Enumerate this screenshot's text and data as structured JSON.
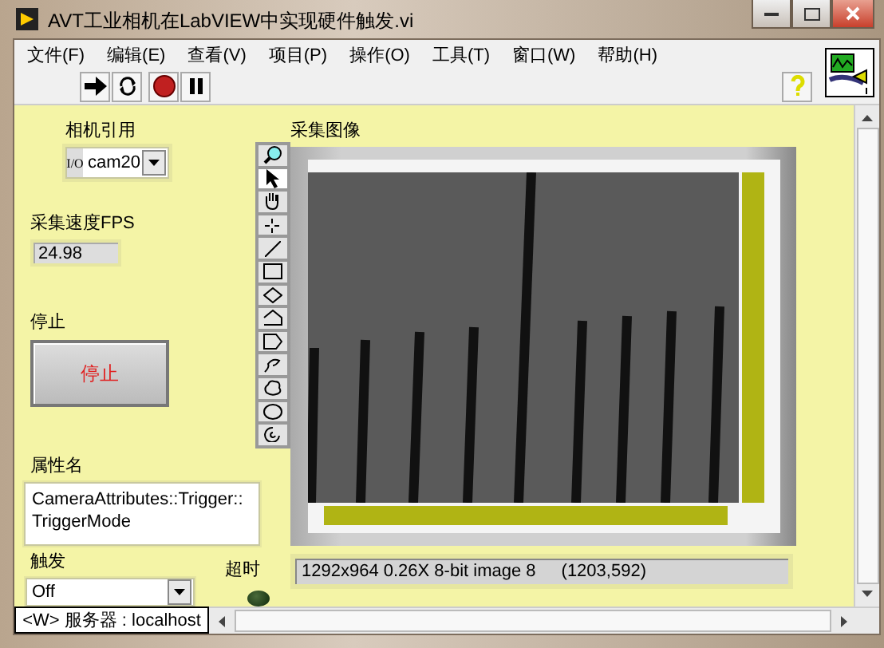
{
  "window": {
    "title": "AVT工业相机在LabVIEW中实现硬件触发.vi"
  },
  "menu": [
    "文件(F)",
    "编辑(E)",
    "查看(V)",
    "项目(P)",
    "操作(O)",
    "工具(T)",
    "窗口(W)",
    "帮助(H)"
  ],
  "camera_reference": {
    "label": "相机引用",
    "type_tag": "I/O",
    "value": "cam20"
  },
  "fps": {
    "label": "采集速度FPS",
    "value": "24.98"
  },
  "stop": {
    "label": "停止",
    "button": "停止"
  },
  "attribute_name": {
    "label": "属性名",
    "value": "CameraAttributes::Trigger::TriggerMode"
  },
  "trigger": {
    "label": "触发",
    "value": "Off"
  },
  "timeout": {
    "label": "超时",
    "on": false
  },
  "image": {
    "label": "采集图像",
    "info": "1292x964 0.26X 8-bit image 8",
    "coordinates": "(1203,592)"
  },
  "tools": [
    {
      "kind": "zoom",
      "selected": false
    },
    {
      "kind": "pointer",
      "selected": true
    },
    {
      "kind": "pan",
      "selected": false
    },
    {
      "kind": "point",
      "selected": false
    },
    {
      "kind": "line",
      "selected": false
    },
    {
      "kind": "rectangle",
      "selected": false
    },
    {
      "kind": "rotated-rectangle",
      "selected": false
    },
    {
      "kind": "polyline",
      "selected": false
    },
    {
      "kind": "polygon",
      "selected": false
    },
    {
      "kind": "freehand",
      "selected": false
    },
    {
      "kind": "freeform",
      "selected": false
    },
    {
      "kind": "oval",
      "selected": false
    },
    {
      "kind": "annulus",
      "selected": false
    }
  ],
  "status_bar": {
    "text": "<W> 服务器 : localhost"
  }
}
